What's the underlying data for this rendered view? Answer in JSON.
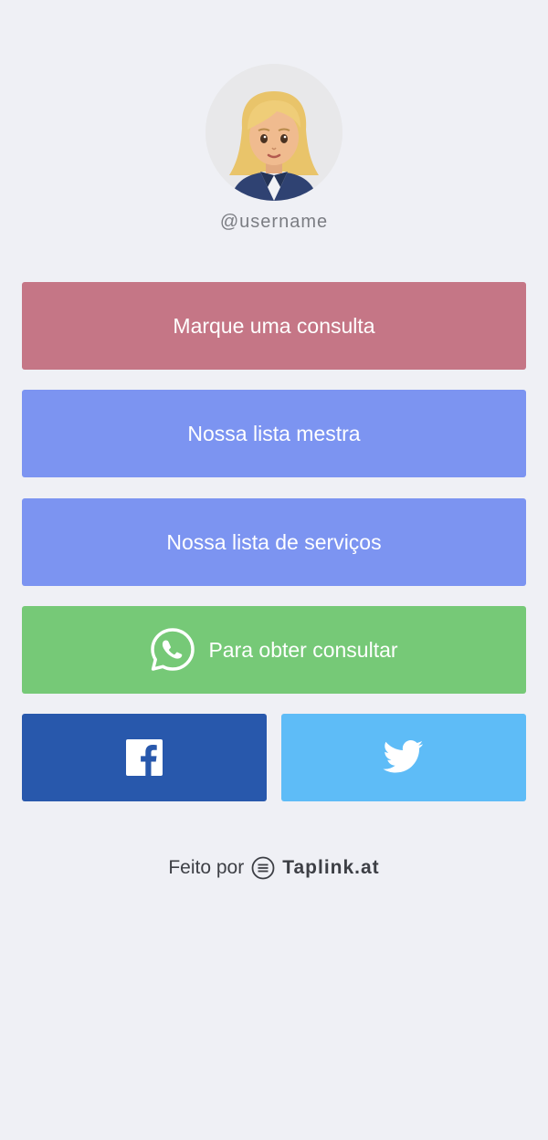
{
  "profile": {
    "username": "@username",
    "avatar_icon": "woman-blond-hair-emoji-icon"
  },
  "buttons": [
    {
      "label": "Marque uma consulta",
      "color": "#c57686"
    },
    {
      "label": "Nossa lista mestra",
      "color": "#7c94f1"
    },
    {
      "label": "Nossa lista de serviços",
      "color": "#7c94f1"
    },
    {
      "label": "Para obter consultar",
      "color": "#76c977",
      "icon": "whatsapp-icon"
    }
  ],
  "social": [
    {
      "name": "facebook",
      "icon": "facebook-icon",
      "color": "#2858ac"
    },
    {
      "name": "twitter",
      "icon": "twitter-icon",
      "color": "#5ebcf7"
    }
  ],
  "footer": {
    "made_by": "Feito por",
    "brand": "Taplink.at",
    "icon": "taplink-logo-icon"
  }
}
